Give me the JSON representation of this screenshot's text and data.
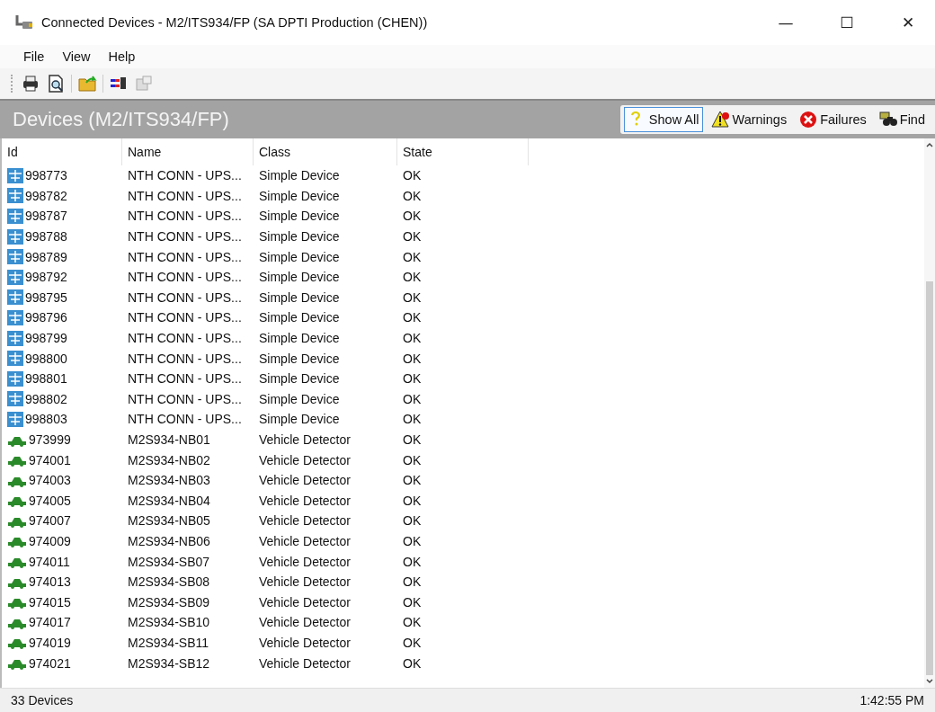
{
  "window": {
    "title": "Connected Devices - M2/ITS934/FP (SA DPTI Production (CHEN))",
    "controls": [
      "—",
      "☐",
      "✕"
    ]
  },
  "menu": [
    "File",
    "View",
    "Help"
  ],
  "panel": {
    "title": "Devices (M2/ITS934/FP)"
  },
  "filters": [
    {
      "kind": "all",
      "label": "Show All",
      "selected": true
    },
    {
      "kind": "warning",
      "label": "Warnings",
      "selected": false
    },
    {
      "kind": "failure",
      "label": "Failures",
      "selected": false
    },
    {
      "kind": "find",
      "label": "Find",
      "selected": false
    }
  ],
  "table": {
    "columns": [
      "Id",
      "Name",
      "Class",
      "State"
    ],
    "rows": [
      {
        "kind": "simple",
        "id": "998773",
        "name": "NTH CONN - UPS...",
        "class": "Simple Device",
        "state": "OK"
      },
      {
        "kind": "simple",
        "id": "998782",
        "name": "NTH CONN - UPS...",
        "class": "Simple Device",
        "state": "OK"
      },
      {
        "kind": "simple",
        "id": "998787",
        "name": "NTH CONN - UPS...",
        "class": "Simple Device",
        "state": "OK"
      },
      {
        "kind": "simple",
        "id": "998788",
        "name": "NTH CONN - UPS...",
        "class": "Simple Device",
        "state": "OK"
      },
      {
        "kind": "simple",
        "id": "998789",
        "name": "NTH CONN - UPS...",
        "class": "Simple Device",
        "state": "OK"
      },
      {
        "kind": "simple",
        "id": "998792",
        "name": "NTH CONN - UPS...",
        "class": "Simple Device",
        "state": "OK"
      },
      {
        "kind": "simple",
        "id": "998795",
        "name": "NTH CONN - UPS...",
        "class": "Simple Device",
        "state": "OK"
      },
      {
        "kind": "simple",
        "id": "998796",
        "name": "NTH CONN - UPS...",
        "class": "Simple Device",
        "state": "OK"
      },
      {
        "kind": "simple",
        "id": "998799",
        "name": "NTH CONN - UPS...",
        "class": "Simple Device",
        "state": "OK"
      },
      {
        "kind": "simple",
        "id": "998800",
        "name": "NTH CONN - UPS...",
        "class": "Simple Device",
        "state": "OK"
      },
      {
        "kind": "simple",
        "id": "998801",
        "name": "NTH CONN - UPS...",
        "class": "Simple Device",
        "state": "OK"
      },
      {
        "kind": "simple",
        "id": "998802",
        "name": "NTH CONN - UPS...",
        "class": "Simple Device",
        "state": "OK"
      },
      {
        "kind": "simple",
        "id": "998803",
        "name": "NTH CONN - UPS...",
        "class": "Simple Device",
        "state": "OK"
      },
      {
        "kind": "vehicle",
        "id": "973999",
        "name": "M2S934-NB01",
        "class": "Vehicle Detector",
        "state": "OK"
      },
      {
        "kind": "vehicle",
        "id": "974001",
        "name": "M2S934-NB02",
        "class": "Vehicle Detector",
        "state": "OK"
      },
      {
        "kind": "vehicle",
        "id": "974003",
        "name": "M2S934-NB03",
        "class": "Vehicle Detector",
        "state": "OK"
      },
      {
        "kind": "vehicle",
        "id": "974005",
        "name": "M2S934-NB04",
        "class": "Vehicle Detector",
        "state": "OK"
      },
      {
        "kind": "vehicle",
        "id": "974007",
        "name": "M2S934-NB05",
        "class": "Vehicle Detector",
        "state": "OK"
      },
      {
        "kind": "vehicle",
        "id": "974009",
        "name": "M2S934-NB06",
        "class": "Vehicle Detector",
        "state": "OK"
      },
      {
        "kind": "vehicle",
        "id": "974011",
        "name": "M2S934-SB07",
        "class": "Vehicle Detector",
        "state": "OK"
      },
      {
        "kind": "vehicle",
        "id": "974013",
        "name": "M2S934-SB08",
        "class": "Vehicle Detector",
        "state": "OK"
      },
      {
        "kind": "vehicle",
        "id": "974015",
        "name": "M2S934-SB09",
        "class": "Vehicle Detector",
        "state": "OK"
      },
      {
        "kind": "vehicle",
        "id": "974017",
        "name": "M2S934-SB10",
        "class": "Vehicle Detector",
        "state": "OK"
      },
      {
        "kind": "vehicle",
        "id": "974019",
        "name": "M2S934-SB11",
        "class": "Vehicle Detector",
        "state": "OK"
      },
      {
        "kind": "vehicle",
        "id": "974021",
        "name": "M2S934-SB12",
        "class": "Vehicle Detector",
        "state": "OK"
      }
    ]
  },
  "status_bar": {
    "count": "33 Devices",
    "time": "1:42:55 PM"
  }
}
